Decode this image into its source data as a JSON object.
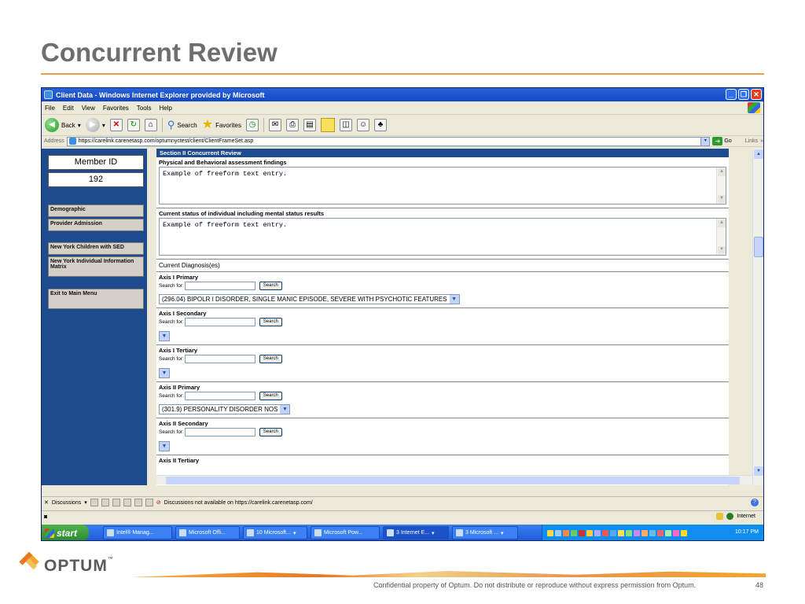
{
  "slide": {
    "title": "Concurrent Review",
    "footer": "Confidential property of Optum. Do not distribute or reproduce without express permission from Optum.",
    "page_number": "48",
    "logo_text": "OPTUM",
    "logo_tm": "™",
    "accent_color": "#e87722"
  },
  "window": {
    "title": "Client Data - Windows Internet Explorer provided by Microsoft",
    "menu": [
      "File",
      "Edit",
      "View",
      "Favorites",
      "Tools",
      "Help"
    ],
    "toolbar": {
      "back": "Back",
      "search": "Search",
      "favorites": "Favorites"
    },
    "address_label": "Address",
    "url": "https://carelink.carenetasp.com/optumnyctest/client/ClientFrameSet.asp",
    "go": "Go",
    "links": "Links"
  },
  "left_panel": {
    "member_id_label": "Member ID",
    "member_id_value": "192",
    "nav": [
      "Demographic",
      "Provider Admission",
      "New York Children with SED",
      "New York Individual Information Matrix",
      "Exit to Main Menu"
    ]
  },
  "main": {
    "section_title": "Section II Concurrent Review",
    "field1_label": "Physical and Behavioral assessment findings",
    "field1_value": "Example of freeform text entry.",
    "field2_label": "Current status of individual including mental status results",
    "field2_value": "Example of freeform text entry.",
    "diagnoses_label": "Current Diagnosis(es)",
    "search_for": "Search for:",
    "search_button": "Search",
    "axes": [
      {
        "title": "Axis I Primary",
        "selected": "(296.04) BIPOLR I DISORDER, SINGLE MANIC EPISODE, SEVERE WITH PSYCHOTIC FEATURES"
      },
      {
        "title": "Axis I Secondary",
        "selected": ""
      },
      {
        "title": "Axis I Tertiary",
        "selected": ""
      },
      {
        "title": "Axis II Primary",
        "selected": "(301.9) PERSONALITY DISORDER NOS"
      },
      {
        "title": "Axis II Secondary",
        "selected": ""
      },
      {
        "title": "Axis II Tertiary",
        "selected": ""
      }
    ]
  },
  "discussions": {
    "label": "Discussions",
    "message": "Discussions not available on https://carelink.carenetasp.com/"
  },
  "status": {
    "zone": "Internet"
  },
  "taskbar": {
    "start": "start",
    "tasks": [
      "Intel® Manag...",
      "Microsoft Offi...",
      "10 Microsoft...",
      "Microsoft Pow...",
      "3 Internet E...",
      "3 Microsoft ..."
    ],
    "clock": "10:17 PM"
  }
}
